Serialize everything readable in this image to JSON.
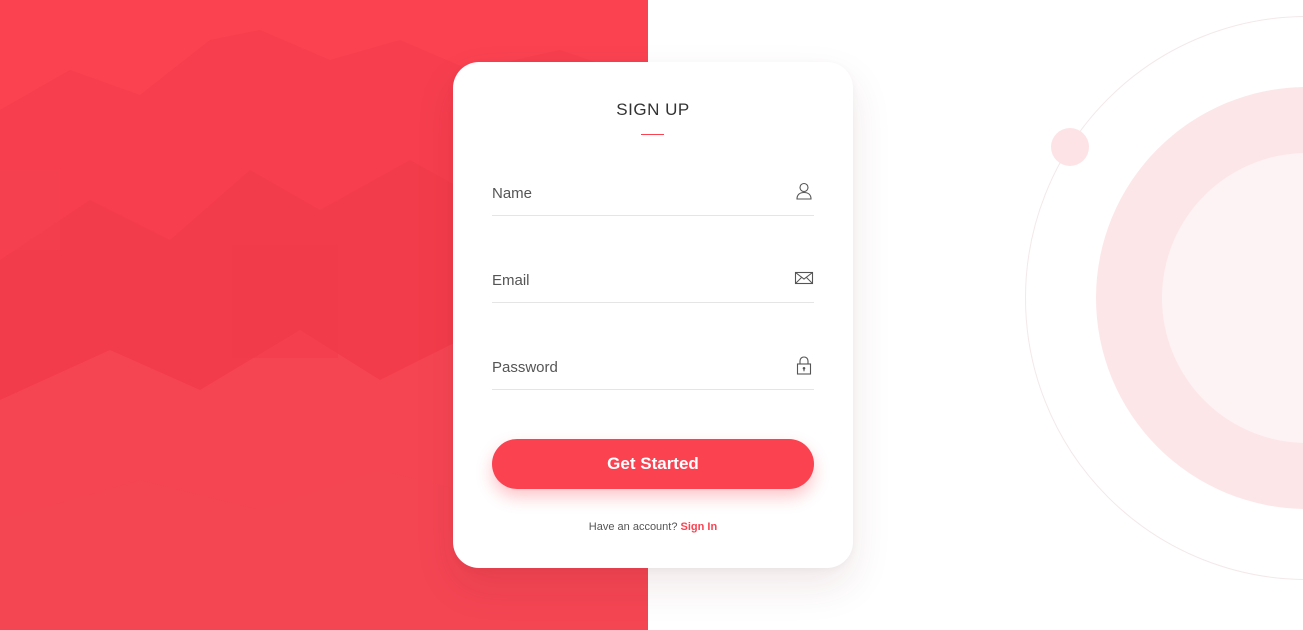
{
  "form": {
    "title": "SIGN UP",
    "name_placeholder": "Name",
    "name_icon": "user-icon",
    "email_placeholder": "Email",
    "email_icon": "envelope-icon",
    "password_placeholder": "Password",
    "password_icon": "lock-icon",
    "submit_label": "Get Started",
    "footer_text": "Have an account?",
    "signin_link": "Sign In"
  },
  "colors": {
    "accent": "#fa4251",
    "background": "#ffffff",
    "deco_ring": "#fde6e8",
    "text": "#333333"
  }
}
